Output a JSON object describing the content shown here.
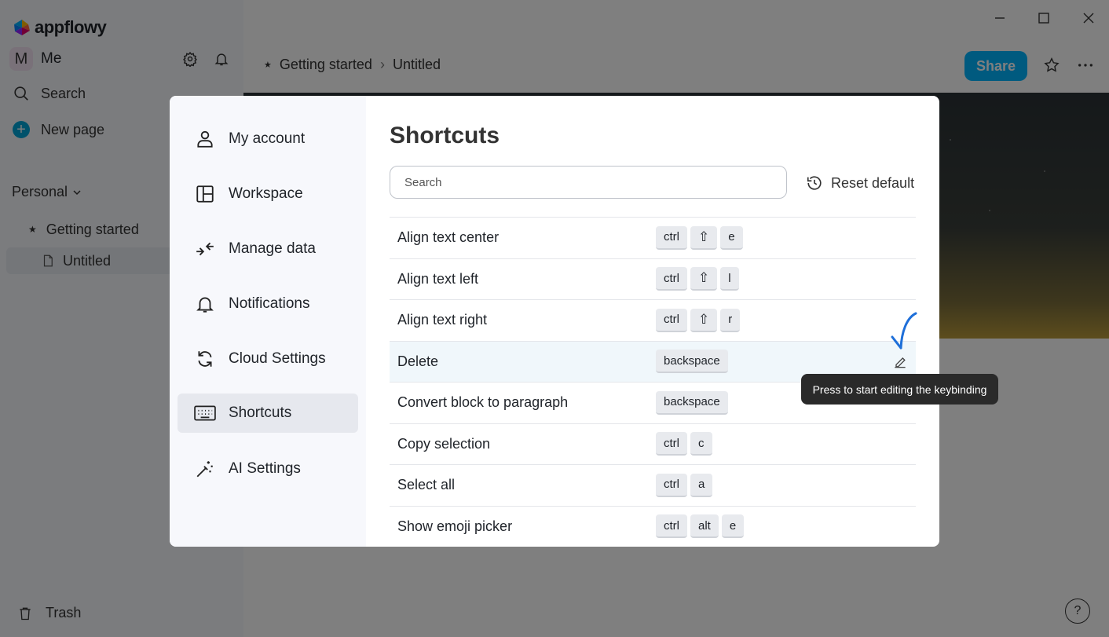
{
  "app": {
    "logo_text": "appflowy"
  },
  "sidebar": {
    "user_initial": "M",
    "user_name": "Me",
    "search_label": "Search",
    "new_page_label": "New page",
    "section_label": "Personal",
    "pages": [
      {
        "label": "Getting started",
        "icon": "star-icon"
      },
      {
        "label": "Untitled",
        "icon": "document-icon"
      }
    ],
    "trash_label": "Trash"
  },
  "topbar": {
    "breadcrumb": [
      "Getting started",
      "Untitled"
    ],
    "share_label": "Share",
    "help_label": "?"
  },
  "settings": {
    "nav": [
      {
        "label": "My account",
        "icon": "person-icon"
      },
      {
        "label": "Workspace",
        "icon": "layout-icon"
      },
      {
        "label": "Manage data",
        "icon": "arrows-in-icon"
      },
      {
        "label": "Notifications",
        "icon": "bell-icon"
      },
      {
        "label": "Cloud Settings",
        "icon": "sync-icon"
      },
      {
        "label": "Shortcuts",
        "icon": "keyboard-icon"
      },
      {
        "label": "AI Settings",
        "icon": "magic-wand-icon"
      }
    ],
    "active_nav": "Shortcuts",
    "title": "Shortcuts",
    "search_placeholder": "Search",
    "reset_label": "Reset default",
    "shortcuts": [
      {
        "label": "Align text center",
        "keys": [
          "ctrl",
          "⇧",
          "e"
        ]
      },
      {
        "label": "Align text left",
        "keys": [
          "ctrl",
          "⇧",
          "l"
        ]
      },
      {
        "label": "Align text right",
        "keys": [
          "ctrl",
          "⇧",
          "r"
        ]
      },
      {
        "label": "Delete",
        "keys": [
          "backspace"
        ]
      },
      {
        "label": "Convert block to paragraph",
        "keys": [
          "backspace"
        ]
      },
      {
        "label": "Copy selection",
        "keys": [
          "ctrl",
          "c"
        ]
      },
      {
        "label": "Select all",
        "keys": [
          "ctrl",
          "a"
        ]
      },
      {
        "label": "Show emoji picker",
        "keys": [
          "ctrl",
          "alt",
          "e"
        ]
      }
    ],
    "tooltip": "Press to start editing the keybinding"
  },
  "colors": {
    "accent": "#00b5ff",
    "tooltip_bg": "#2a2a2a",
    "highlight_row": "#f0f7fb"
  }
}
